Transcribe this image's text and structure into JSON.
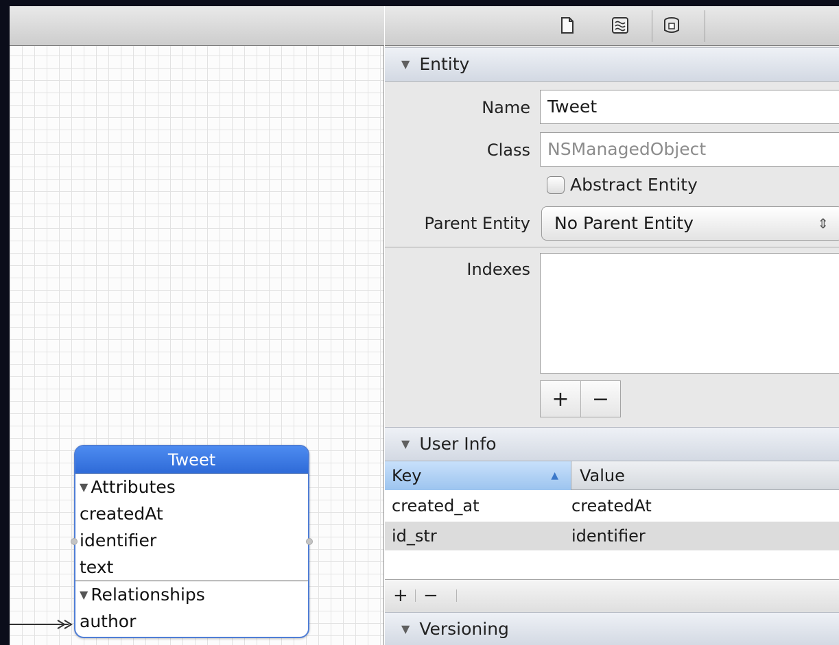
{
  "entity_diagram": {
    "title": "Tweet",
    "attributes_header": "Attributes",
    "attributes": [
      "createdAt",
      "identifier",
      "text"
    ],
    "relationships_header": "Relationships",
    "relationships": [
      "author"
    ]
  },
  "toolbar": {
    "icons": [
      "file-inspector-icon",
      "quick-help-icon",
      "data-model-inspector-icon"
    ]
  },
  "entity_section": {
    "title": "Entity",
    "name_label": "Name",
    "name_value": "Tweet",
    "class_label": "Class",
    "class_placeholder": "NSManagedObject",
    "abstract_label": "Abstract Entity",
    "abstract_checked": false,
    "parent_label": "Parent Entity",
    "parent_value": "No Parent Entity",
    "indexes_label": "Indexes",
    "add_label": "+",
    "remove_label": "−"
  },
  "user_info": {
    "title": "User Info",
    "columns": {
      "key": "Key",
      "value": "Value"
    },
    "rows": [
      {
        "key": "created_at",
        "value": "createdAt"
      },
      {
        "key": "id_str",
        "value": "identifier"
      }
    ],
    "add_label": "+",
    "remove_label": "−"
  },
  "versioning": {
    "title": "Versioning"
  },
  "colors": {
    "entity_title_blue": "#2f6bd8",
    "selected_header": "#9cc4ef",
    "section_header": "#d3d9e3"
  }
}
